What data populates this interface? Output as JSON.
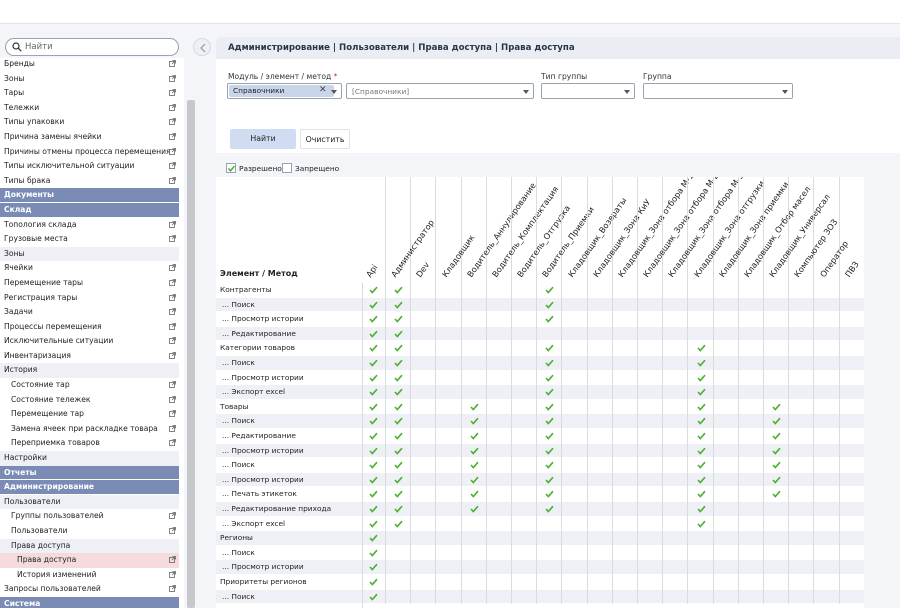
{
  "search": {
    "placeholder": "Найти"
  },
  "sidebar": {
    "items": [
      {
        "label": "Бренды",
        "type": "item",
        "ext": true
      },
      {
        "label": "Зоны",
        "type": "item",
        "ext": true
      },
      {
        "label": "Тары",
        "type": "item",
        "ext": true
      },
      {
        "label": "Тележки",
        "type": "item",
        "ext": true
      },
      {
        "label": "Типы упаковки",
        "type": "item",
        "ext": true
      },
      {
        "label": "Причина замены ячейки",
        "type": "item",
        "ext": true
      },
      {
        "label": "Причины отмены процесса перемещения",
        "type": "item",
        "ext": true
      },
      {
        "label": "Типы исключительной ситуации",
        "type": "item",
        "ext": true
      },
      {
        "label": "Типы брака",
        "type": "item",
        "ext": true
      },
      {
        "label": "Документы",
        "type": "section",
        "ext": false
      },
      {
        "label": "Склад",
        "type": "section",
        "ext": false
      },
      {
        "label": "Топология склада",
        "type": "item",
        "ext": true
      },
      {
        "label": "Грузовые места",
        "type": "item",
        "ext": true
      },
      {
        "label": "Зоны",
        "type": "group",
        "ext": false
      },
      {
        "label": "Ячейки",
        "type": "item",
        "ext": true
      },
      {
        "label": "Перемещение тары",
        "type": "item",
        "ext": true
      },
      {
        "label": "Регистрация тары",
        "type": "item",
        "ext": true
      },
      {
        "label": "Задачи",
        "type": "item",
        "ext": true
      },
      {
        "label": "Процессы перемещения",
        "type": "item",
        "ext": true
      },
      {
        "label": "Исключительные ситуации",
        "type": "item",
        "ext": true
      },
      {
        "label": "Инвентаризация",
        "type": "item",
        "ext": true
      },
      {
        "label": "История",
        "type": "group",
        "ext": false
      },
      {
        "label": "Состояние тар",
        "type": "ind1",
        "ext": true
      },
      {
        "label": "Состояние тележек",
        "type": "ind1",
        "ext": true
      },
      {
        "label": "Перемещение тар",
        "type": "ind1",
        "ext": true
      },
      {
        "label": "Замена ячеек при раскладке товара",
        "type": "ind1",
        "ext": true
      },
      {
        "label": "Переприемка товаров",
        "type": "ind1",
        "ext": true
      },
      {
        "label": "Настройки",
        "type": "group",
        "ext": false
      },
      {
        "label": "Отчеты",
        "type": "section",
        "ext": false
      },
      {
        "label": "Администрирование",
        "type": "section",
        "ext": false
      },
      {
        "label": "Пользователи",
        "type": "group",
        "ext": false
      },
      {
        "label": "Группы пользователей",
        "type": "ind1",
        "ext": true
      },
      {
        "label": "Пользователи",
        "type": "ind1",
        "ext": true
      },
      {
        "label": "Права доступа",
        "type": "ind1grp",
        "ext": false
      },
      {
        "label": "Права доступа",
        "type": "ind2active",
        "ext": true
      },
      {
        "label": "История изменений",
        "type": "ind2",
        "ext": true
      },
      {
        "label": "Запросы пользователей",
        "type": "item",
        "ext": true
      },
      {
        "label": "Система",
        "type": "section",
        "ext": false
      }
    ]
  },
  "header": {
    "title": "Администрирование | Пользователи | Права доступа | Права доступа"
  },
  "filters": {
    "module_label": "Модуль / элемент / метод",
    "required_mark": "*",
    "module_tag": "Справочники",
    "module_sub_placeholder": "[Справочники]",
    "group_type_label": "Тип группы",
    "group_label": "Группа",
    "find_label": "Найти",
    "clear_label": "Очистить"
  },
  "legend": {
    "allowed": "Разрешено",
    "denied": "Запрещено"
  },
  "grid": {
    "row_header": "Элемент / Метод",
    "columns": [
      "Api",
      "Администратор",
      "Dev",
      "Кладовщик",
      "Водитель_Аннулирование",
      "Водитель_Комплектация",
      "Водитель_Отгрузка",
      "Водитель_Приемки",
      "Кладовщик_Возвраты",
      "Кладовщик_Зона КиУ",
      "Кладовщик_Зона отбора М-1",
      "Кладовщик_Зона отбора М-2",
      "Кладовщик_Зона отбора М-3",
      "Кладовщик_Зона отгрузки",
      "Кладовщик_Зона приемки",
      "Кладовщик_Отбор масел",
      "Кладовщик_Универсал",
      "Компьютер ЗОЗ",
      "Оператор",
      "ПВЗ"
    ],
    "rows": [
      {
        "label": "Контрагенты",
        "child": false,
        "checks": [
          0,
          1,
          7
        ]
      },
      {
        "label": "...  Поиск",
        "child": true,
        "checks": [
          0,
          1,
          7
        ]
      },
      {
        "label": "...  Просмотр истории",
        "child": true,
        "checks": [
          0,
          1,
          7
        ]
      },
      {
        "label": "...  Редактирование",
        "child": true,
        "checks": [
          0,
          1
        ]
      },
      {
        "label": "Категории товаров",
        "child": false,
        "checks": [
          0,
          1,
          7,
          13
        ]
      },
      {
        "label": "...  Поиск",
        "child": true,
        "checks": [
          0,
          1,
          7,
          13
        ]
      },
      {
        "label": "...  Просмотр истории",
        "child": true,
        "checks": [
          0,
          1,
          7,
          13
        ]
      },
      {
        "label": "...  Экспорт excel",
        "child": true,
        "checks": [
          0,
          1,
          7,
          13
        ]
      },
      {
        "label": "Товары",
        "child": false,
        "checks": [
          0,
          1,
          4,
          7,
          13,
          16
        ]
      },
      {
        "label": "...  Поиск",
        "child": true,
        "checks": [
          0,
          1,
          4,
          7,
          13,
          16
        ]
      },
      {
        "label": "...  Редактирование",
        "child": true,
        "checks": [
          0,
          1,
          4,
          7,
          13,
          16
        ]
      },
      {
        "label": "...  Просмотр истории",
        "child": true,
        "checks": [
          0,
          1,
          4,
          7,
          13,
          16
        ]
      },
      {
        "label": "...  Поиск",
        "child": true,
        "checks": [
          0,
          1,
          4,
          7,
          13,
          16
        ]
      },
      {
        "label": "...  Просмотр истории",
        "child": true,
        "checks": [
          0,
          1,
          4,
          7,
          13,
          16
        ]
      },
      {
        "label": "...  Печать этикеток",
        "child": true,
        "checks": [
          0,
          1,
          4,
          7,
          13,
          16
        ]
      },
      {
        "label": "...  Редактирование прихода",
        "child": true,
        "checks": [
          0,
          1,
          4,
          7,
          13
        ]
      },
      {
        "label": "...  Экспорт excel",
        "child": true,
        "checks": [
          0,
          1,
          13
        ]
      },
      {
        "label": "Регионы",
        "child": false,
        "checks": [
          0
        ]
      },
      {
        "label": "...  Поиск",
        "child": true,
        "checks": [
          0
        ]
      },
      {
        "label": "...  Просмотр истории",
        "child": true,
        "checks": [
          0
        ]
      },
      {
        "label": "Приоритеты регионов",
        "child": false,
        "checks": [
          0
        ]
      },
      {
        "label": "...  Поиск",
        "child": true,
        "checks": [
          0
        ]
      }
    ]
  },
  "colors": {
    "accent": "#7a8cb6",
    "check": "#4caf32",
    "active": "#f6dbdc"
  }
}
